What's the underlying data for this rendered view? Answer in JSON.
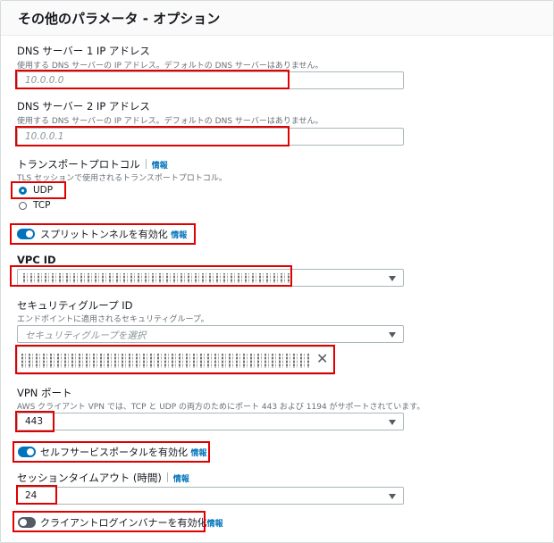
{
  "header": {
    "title": "その他のパラメータ - オプション"
  },
  "dns1": {
    "label": "DNS サーバー 1 IP アドレス",
    "desc": "使用する DNS サーバーの IP アドレス。デフォルトの DNS サーバーはありません。",
    "placeholder": "10.0.0.0"
  },
  "dns2": {
    "label": "DNS サーバー 2 IP アドレス",
    "desc": "使用する DNS サーバーの IP アドレス。デフォルトの DNS サーバーはありません。",
    "placeholder": "10.0.0.1"
  },
  "transport": {
    "label": "トランスポートプロトコル",
    "info": "情報",
    "desc": "TLS セッションで使用されるトランスポートプロトコル。",
    "options": [
      "UDP",
      "TCP"
    ],
    "selected": "UDP"
  },
  "split_tunnel": {
    "label": "スプリットトンネルを有効化",
    "info": "情報",
    "enabled": true
  },
  "vpc": {
    "label": "VPC ID"
  },
  "security_group": {
    "label": "セキュリティグループ ID",
    "desc": "エンドポイントに適用されるセキュリティグループ。",
    "placeholder": "セキュリティグループを選択"
  },
  "vpn_port": {
    "label": "VPN ポート",
    "desc": "AWS クライアント VPN では、TCP と UDP の両方のためにポート 443 および 1194 がサポートされています。",
    "value": "443"
  },
  "self_service": {
    "label": "セルフサービスポータルを有効化",
    "info": "情報",
    "enabled": true
  },
  "session_timeout": {
    "label": "セッションタイムアウト (時間)",
    "info": "情報",
    "value": "24"
  },
  "client_banner": {
    "label": "クライアントログインバナーを有効化",
    "info": "情報",
    "enabled": false
  },
  "colors": {
    "highlight": "#e00000",
    "accent": "#0073bb"
  }
}
